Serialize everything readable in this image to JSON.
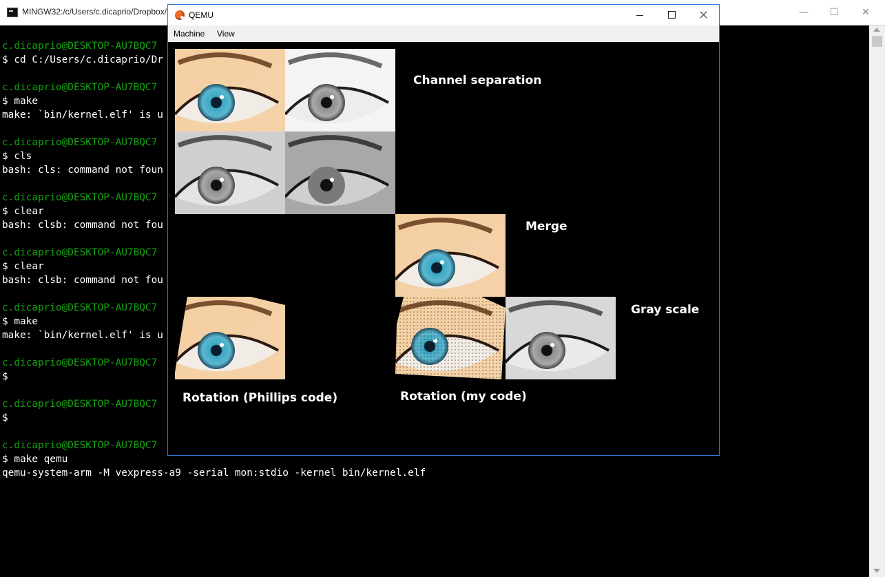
{
  "terminal": {
    "title": "MINGW32:/c/Users/c.dicaprio/Dropbox/",
    "buttons": {
      "minimize": "—",
      "maximize": "☐",
      "close": "✕"
    },
    "lines": [
      {
        "text": "c.dicaprio@DESKTOP-AU7BQC7",
        "style": "prompt"
      },
      {
        "text": "$ cd C:/Users/c.dicaprio/Dr",
        "style": "cmd"
      },
      {
        "text": "",
        "style": "cmd"
      },
      {
        "text": "c.dicaprio@DESKTOP-AU7BQC7",
        "style": "prompt"
      },
      {
        "text": "$ make",
        "style": "cmd"
      },
      {
        "text": "make: `bin/kernel.elf' is u",
        "style": "cmd"
      },
      {
        "text": "",
        "style": "cmd"
      },
      {
        "text": "c.dicaprio@DESKTOP-AU7BQC7",
        "style": "prompt"
      },
      {
        "text": "$ cls",
        "style": "cmd"
      },
      {
        "text": "bash: cls: command not foun",
        "style": "cmd"
      },
      {
        "text": "",
        "style": "cmd"
      },
      {
        "text": "c.dicaprio@DESKTOP-AU7BQC7",
        "style": "prompt"
      },
      {
        "text": "$ clear",
        "style": "cmd"
      },
      {
        "text": "bash: clsb: command not fou",
        "style": "cmd"
      },
      {
        "text": "",
        "style": "cmd"
      },
      {
        "text": "c.dicaprio@DESKTOP-AU7BQC7",
        "style": "prompt"
      },
      {
        "text": "$ clear",
        "style": "cmd"
      },
      {
        "text": "bash: clsb: command not fou",
        "style": "cmd"
      },
      {
        "text": "",
        "style": "cmd"
      },
      {
        "text": "c.dicaprio@DESKTOP-AU7BQC7",
        "style": "prompt"
      },
      {
        "text": "$ make",
        "style": "cmd"
      },
      {
        "text": "make: `bin/kernel.elf' is u",
        "style": "cmd"
      },
      {
        "text": "",
        "style": "cmd"
      },
      {
        "text": "c.dicaprio@DESKTOP-AU7BQC7",
        "style": "prompt"
      },
      {
        "text": "$",
        "style": "cmd"
      },
      {
        "text": "",
        "style": "cmd"
      },
      {
        "text": "c.dicaprio@DESKTOP-AU7BQC7",
        "style": "prompt"
      },
      {
        "text": "$",
        "style": "cmd"
      },
      {
        "text": "",
        "style": "cmd"
      },
      {
        "text": "c.dicaprio@DESKTOP-AU7BQC7",
        "style": "prompt"
      },
      {
        "text": "$ make qemu",
        "style": "cmd"
      },
      {
        "text": "qemu-system-arm -M vexpress-a9 -serial mon:stdio -kernel bin/kernel.elf",
        "style": "cmd"
      }
    ],
    "colors": {
      "prompt": "#13a10e",
      "text": "#ffffff",
      "background": "#000000"
    }
  },
  "qemu": {
    "title": "QEMU",
    "menu": [
      {
        "label": "Machine"
      },
      {
        "label": "View"
      }
    ],
    "captions": {
      "channel_separation": "Channel separation",
      "merge": "Merge",
      "gray_scale": "Gray scale",
      "rotation_phillips": "Rotation (Phillips code)",
      "rotation_mine": "Rotation (my code)"
    },
    "colors": {
      "accent": "#2b78d4"
    }
  }
}
